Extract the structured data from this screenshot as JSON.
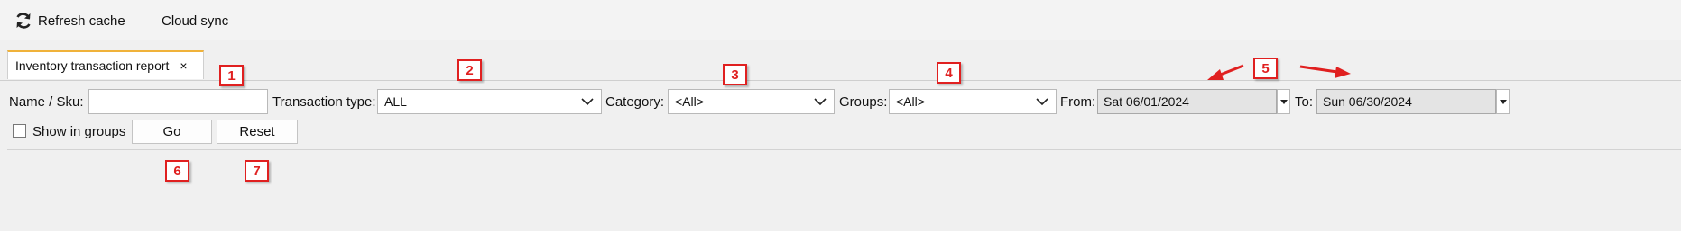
{
  "toolbar": {
    "refresh_label": "Refresh cache",
    "cloud_sync_label": "Cloud sync"
  },
  "tab": {
    "title": "Inventory transaction report",
    "close_glyph": "×"
  },
  "filters": {
    "name_sku_label": "Name / Sku:",
    "name_sku_value": "",
    "transaction_type_label": "Transaction type:",
    "transaction_type_value": "ALL",
    "category_label": "Category:",
    "category_value": "<All>",
    "groups_label": "Groups:",
    "groups_value": "<All>",
    "from_label": "From:",
    "from_value": "Sat 06/01/2024",
    "to_label": "To:",
    "to_value": "Sun 06/30/2024",
    "show_in_groups_label": "Show in groups",
    "show_in_groups_checked": false
  },
  "buttons": {
    "go_label": "Go",
    "reset_label": "Reset"
  },
  "callouts": [
    "1",
    "2",
    "3",
    "4",
    "5",
    "6",
    "7"
  ],
  "colors": {
    "tab_accent": "#f0b23a",
    "callout": "#e02020"
  }
}
